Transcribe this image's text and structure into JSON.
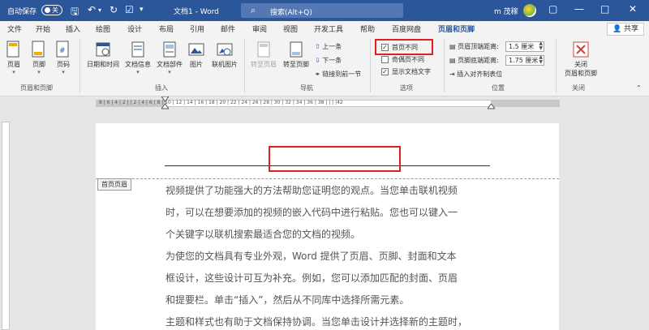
{
  "title_bar": {
    "autosave_label": "自动保存",
    "autosave_state": "关",
    "doc_title": "文档1 - Word",
    "search_placeholder": "搜索(Alt+Q)",
    "user_name": "m 茂稼"
  },
  "menu_tabs": [
    "文件",
    "开始",
    "插入",
    "绘图",
    "设计",
    "布局",
    "引用",
    "邮件",
    "审阅",
    "视图",
    "开发工具",
    "帮助",
    "百度网盘",
    "页眉和页脚"
  ],
  "active_tab": "页眉和页脚",
  "share_label": "共享",
  "ribbon": {
    "group1": {
      "label": "页眉和页脚",
      "buttons": [
        "页眉",
        "页脚",
        "页码"
      ]
    },
    "group2": {
      "label": "插入",
      "buttons": [
        "日期和时间",
        "文档信息",
        "文档部件",
        "图片",
        "联机图片"
      ]
    },
    "group3": {
      "label": "导航",
      "buttons": [
        "转至页眉",
        "转至页脚"
      ],
      "small": [
        "上一条",
        "下一条",
        "链接到前一节"
      ]
    },
    "group4": {
      "label": "选项",
      "checks": [
        "首页不同",
        "奇偶页不同",
        "显示文档文字"
      ]
    },
    "group5": {
      "label": "位置",
      "header_dist_label": "页眉顶端距离:",
      "header_dist_value": "1.5 厘米",
      "footer_dist_label": "页脚底端距离:",
      "footer_dist_value": "1.75 厘米",
      "align_tab": "插入对齐制表位"
    },
    "group6": {
      "label": "关闭",
      "button_line1": "关闭",
      "button_line2": "页眉和页脚"
    }
  },
  "ruler_text": "8  |  6  |  4  |  2  |        |  2  |  4  |  6  |  8  | 10 | 12 | 14 | 16 | 18 | 20 | 22 | 24 | 26 | 28 | 30 | 32 | 34 | 36 | 38 |  |  |  |42",
  "document": {
    "header_tag": "首页页眉",
    "lines": [
      "视频提供了功能强大的方法帮助您证明您的观点。当您单击联机视频",
      "时，可以在想要添加的视频的嵌入代码中进行粘贴。您也可以键入一",
      "个关键字以联机搜索最适合您的文档的视频。",
      "为使您的文档具有专业外观，Word 提供了页眉、页脚、封面和文本",
      "框设计，这些设计可互为补充。例如，您可以添加匹配的封面、页眉",
      "和提要栏。单击“插入”，然后从不同库中选择所需元素。",
      "主题和样式也有助于文档保持协调。当您单击设计并选择新的主题时，"
    ]
  },
  "colors": {
    "title_bar": "#2b579a",
    "highlight": "#e02020"
  }
}
